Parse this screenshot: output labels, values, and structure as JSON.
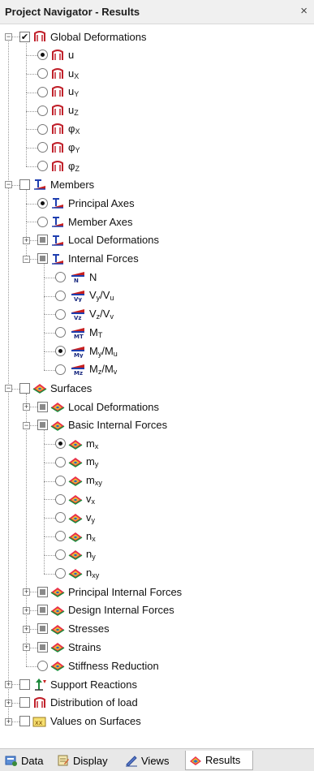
{
  "window": {
    "title": "Project Navigator - Results",
    "close_glyph": "×"
  },
  "tree": {
    "global_deformations": {
      "label": "Global Deformations",
      "items": [
        {
          "base": "u",
          "sub": ""
        },
        {
          "base": "u",
          "sub": "X"
        },
        {
          "base": "u",
          "sub": "Y"
        },
        {
          "base": "u",
          "sub": "Z"
        },
        {
          "base": "φ",
          "sub": "X"
        },
        {
          "base": "φ",
          "sub": "Y"
        },
        {
          "base": "φ",
          "sub": "Z"
        }
      ]
    },
    "members": {
      "label": "Members",
      "principal_axes": "Principal Axes",
      "member_axes": "Member Axes",
      "local_deformations": "Local Deformations",
      "internal_forces": {
        "label": "Internal Forces",
        "items": [
          {
            "label": "N",
            "icon_text": "N"
          },
          {
            "label": "Vᵧ/Vᵤ",
            "html": [
              "V",
              "y",
              "/V",
              "u"
            ],
            "icon_text": "Vy"
          },
          {
            "label": "Vz/Vv",
            "html": [
              "V",
              "z",
              "/V",
              "v"
            ],
            "icon_text": "Vz"
          },
          {
            "label": "MT",
            "html": [
              "M",
              "T",
              "",
              ""
            ],
            "icon_text": "MT"
          },
          {
            "label": "My/Mu",
            "html": [
              "M",
              "y",
              "/M",
              "u"
            ],
            "icon_text": "My"
          },
          {
            "label": "Mz/Mv",
            "html": [
              "M",
              "z",
              "/M",
              "v"
            ],
            "icon_text": "Mz"
          }
        ]
      }
    },
    "surfaces": {
      "label": "Surfaces",
      "local_deformations": "Local Deformations",
      "basic_internal_forces": {
        "label": "Basic Internal Forces",
        "items": [
          {
            "base": "m",
            "sub": "x"
          },
          {
            "base": "m",
            "sub": "y"
          },
          {
            "base": "m",
            "sub": "xy"
          },
          {
            "base": "v",
            "sub": "x"
          },
          {
            "base": "v",
            "sub": "y"
          },
          {
            "base": "n",
            "sub": "x"
          },
          {
            "base": "n",
            "sub": "y"
          },
          {
            "base": "n",
            "sub": "xy"
          }
        ]
      },
      "principal_internal_forces": "Principal Internal Forces",
      "design_internal_forces": "Design Internal Forces",
      "stresses": "Stresses",
      "strains": "Strains",
      "stiffness_reduction": "Stiffness Reduction"
    },
    "support_reactions": "Support Reactions",
    "distribution_of_load": "Distribution of load",
    "values_on_surfaces": "Values on Surfaces"
  },
  "tabs": [
    {
      "label": "Data",
      "icon": "data-icon"
    },
    {
      "label": "Display",
      "icon": "display-icon"
    },
    {
      "label": "Views",
      "icon": "views-icon"
    },
    {
      "label": "Results",
      "icon": "results-icon",
      "active": true
    }
  ],
  "colors": {
    "deform_icon": "#c0202a",
    "member_icon_blue": "#1f3fb0",
    "member_icon_red": "#c82020",
    "surface_icon": "#e8304a",
    "surface_icon_blue": "#3060c0"
  }
}
